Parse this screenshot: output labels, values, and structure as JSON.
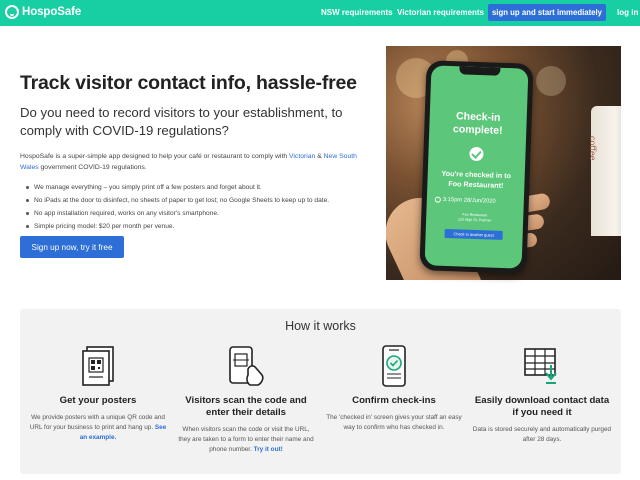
{
  "nav": {
    "logo": "HospoSafe",
    "links": [
      "NSW requirements",
      "Victorian requirements"
    ],
    "cta": "sign up and start immediately",
    "login": "log in"
  },
  "hero": {
    "title": "Track visitor contact info, hassle-free",
    "subtitle": "Do you need to record visitors to your establishment, to comply with COVID-19 regulations?",
    "desc_pre": "HospoSafe is a super-simple app designed to help your café or restaurant to comply with ",
    "desc_link1": "Victorian",
    "desc_mid": " & ",
    "desc_link2": "New South Wales",
    "desc_post": " government COVID-19 regulations.",
    "bullets": [
      "We manage everything – you simply print off a few posters and forget about it.",
      "No iPads at the door to disinfect, no sheets of paper to get lost; no Google Sheets to keep up to date.",
      "No app installation required, works on any visitor's smartphone.",
      "Simple pricing model: $20 per month per venue."
    ],
    "cta": "Sign up now, try it free"
  },
  "phone": {
    "title_line1": "Check-in",
    "title_line2": "complete!",
    "message": "You're checked in to",
    "venue": "Foo Restaurant!",
    "time": "3:15pm 28/Jun/2020",
    "address_line1": "Foo Restaurant",
    "address_line2": "123 High St, Prahran",
    "button": "Check-in another guest",
    "cup_text": "coffee"
  },
  "how": {
    "title": "How it works",
    "steps": [
      {
        "icon": "poster-qr-icon",
        "title": "Get your posters",
        "desc": "We provide posters with a unique QR code and URL for your business to print and hang up.",
        "link": "See an example."
      },
      {
        "icon": "phone-scan-icon",
        "title": "Visitors scan the code and enter their details",
        "desc": "When visitors scan the code or visit the URL, they are taken to a form to enter their name and phone number.",
        "link": "Try it out!"
      },
      {
        "icon": "phone-check-icon",
        "title": "Confirm check-ins",
        "desc": "The 'checked in' screen gives your staff an easy way to confirm who has checked in.",
        "link": ""
      },
      {
        "icon": "download-spreadsheet-icon",
        "title": "Easily download contact data if you need it",
        "desc": "Data is stored securely and automatically purged after 28 days.",
        "link": ""
      }
    ]
  },
  "colors": {
    "brand": "#17cfa2",
    "accent": "#2d6fd6",
    "phone_screen": "#5cc77a"
  }
}
